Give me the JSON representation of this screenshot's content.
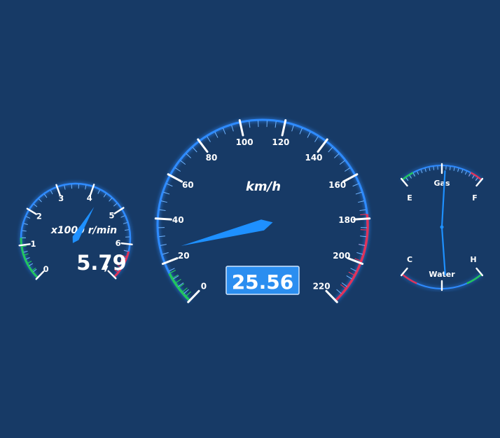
{
  "colors": {
    "background": "#173a66",
    "ring": "#2e8bff",
    "needle": "#1e90ff",
    "green": "#22c55e",
    "red": "#e0335a",
    "readout_fill": "#2b8ef0"
  },
  "chart_data": [
    {
      "type": "gauge",
      "name": "tachometer",
      "unit": "x1000 r/min",
      "min": 0,
      "max": 7,
      "tick_labels": [
        "0",
        "1",
        "2",
        "3",
        "4",
        "5",
        "6",
        "7"
      ],
      "value": 4.3,
      "readout": "5.79",
      "green_band": [
        0,
        1.2
      ],
      "red_band": [
        6.2,
        7
      ]
    },
    {
      "type": "gauge",
      "name": "speedometer",
      "unit": "km/h",
      "min": 0,
      "max": 220,
      "tick_labels": [
        "0",
        "20",
        "40",
        "60",
        "80",
        "100",
        "120",
        "140",
        "160",
        "180",
        "200",
        "220"
      ],
      "value": 25.56,
      "readout": "25.56",
      "green_band": [
        0,
        15
      ],
      "red_band": [
        178,
        220
      ]
    },
    {
      "type": "gauge",
      "name": "fuel",
      "label": "Gas",
      "min_label": "E",
      "max_label": "F",
      "min": 0,
      "max": 1,
      "value": 0.54,
      "green_band": [
        0,
        0.15
      ],
      "red_band": [
        0.85,
        1
      ]
    },
    {
      "type": "gauge",
      "name": "water-temperature",
      "label": "Water",
      "min_label": "C",
      "max_label": "H",
      "min": 0,
      "max": 1,
      "value": 0.55,
      "red_band": [
        0,
        0.2
      ],
      "green_band": [
        0.8,
        1
      ]
    }
  ]
}
